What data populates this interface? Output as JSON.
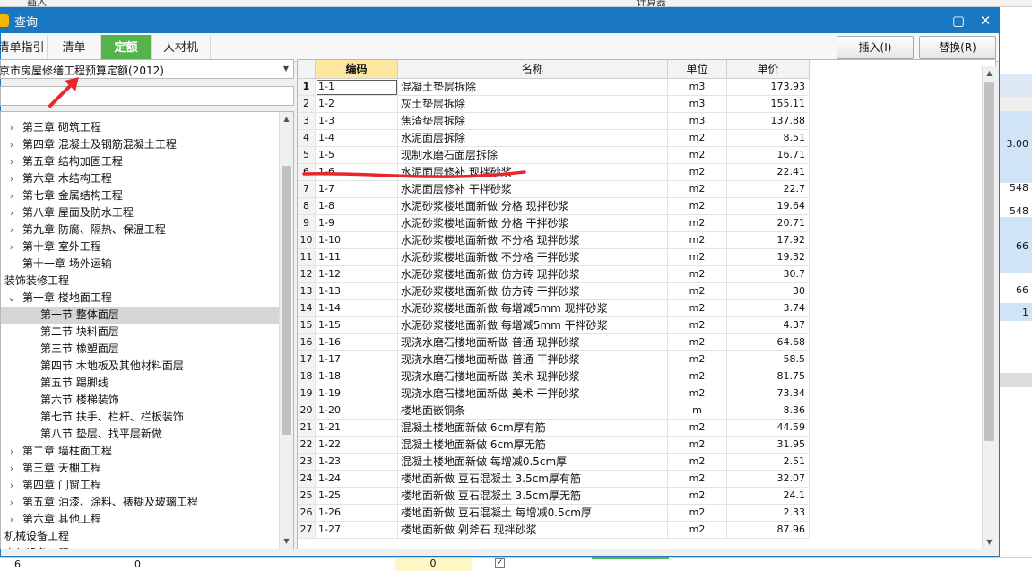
{
  "background": {
    "top_insert_label": "插入",
    "top_calc_label": "计算器",
    "right_values": [
      "3.00",
      "548",
      "548",
      "66",
      "66",
      "1"
    ],
    "bottom_values": [
      "6",
      "0",
      "0"
    ]
  },
  "dialog": {
    "title": "查询",
    "tabs": [
      "清单指引",
      "清单",
      "定额",
      "人材机"
    ],
    "active_tab": 2,
    "insert_label": "插入(I)",
    "replace_label": "替换(R)"
  },
  "left": {
    "library": "京市房屋修缮工程预算定额(2012)",
    "tree": [
      {
        "label": "第三章 砌筑工程",
        "level": 1,
        "toggle": ">"
      },
      {
        "label": "第四章 混凝土及钢筋混凝土工程",
        "level": 1,
        "toggle": ">"
      },
      {
        "label": "第五章 结构加固工程",
        "level": 1,
        "toggle": ">"
      },
      {
        "label": "第六章 木结构工程",
        "level": 1,
        "toggle": ">"
      },
      {
        "label": "第七章 金属结构工程",
        "level": 1,
        "toggle": ">"
      },
      {
        "label": "第八章 屋面及防水工程",
        "level": 1,
        "toggle": ">"
      },
      {
        "label": "第九章 防腐、隔热、保温工程",
        "level": 1,
        "toggle": ">"
      },
      {
        "label": "第十章 室外工程",
        "level": 1,
        "toggle": ">"
      },
      {
        "label": "第十一章 场外运输",
        "level": 1,
        "toggle": ""
      },
      {
        "label": "装饰装修工程",
        "level": 0,
        "toggle": ""
      },
      {
        "label": "第一章 楼地面工程",
        "level": 1,
        "toggle": "v"
      },
      {
        "label": "第一节 整体面层",
        "level": 2,
        "toggle": "",
        "selected": true
      },
      {
        "label": "第二节 块料面层",
        "level": 2,
        "toggle": ""
      },
      {
        "label": "第三节 橡塑面层",
        "level": 2,
        "toggle": ""
      },
      {
        "label": "第四节 木地板及其他材料面层",
        "level": 2,
        "toggle": ""
      },
      {
        "label": "第五节 踢脚线",
        "level": 2,
        "toggle": ""
      },
      {
        "label": "第六节 楼梯装饰",
        "level": 2,
        "toggle": ""
      },
      {
        "label": "第七节 扶手、栏杆、栏板装饰",
        "level": 2,
        "toggle": ""
      },
      {
        "label": "第八节 垫层、找平层新做",
        "level": 2,
        "toggle": ""
      },
      {
        "label": "第二章 墙柱面工程",
        "level": 1,
        "toggle": ">"
      },
      {
        "label": "第三章 天棚工程",
        "level": 1,
        "toggle": ">"
      },
      {
        "label": "第四章 门窗工程",
        "level": 1,
        "toggle": ">"
      },
      {
        "label": "第五章 油漆、涂料、裱糊及玻璃工程",
        "level": 1,
        "toggle": ">"
      },
      {
        "label": "第六章 其他工程",
        "level": 1,
        "toggle": ">"
      },
      {
        "label": "机械设备工程",
        "level": 0,
        "toggle": ""
      },
      {
        "label": "电气设备工程",
        "level": 0,
        "toggle": ""
      }
    ]
  },
  "grid": {
    "headers": {
      "code": "编码",
      "name": "名称",
      "unit": "单位",
      "price": "单价"
    },
    "rows": [
      {
        "n": "1",
        "code": "1-1",
        "name": "混凝土垫层拆除",
        "unit": "m3",
        "price": "173.93"
      },
      {
        "n": "2",
        "code": "1-2",
        "name": "灰土垫层拆除",
        "unit": "m3",
        "price": "155.11"
      },
      {
        "n": "3",
        "code": "1-3",
        "name": "焦渣垫层拆除",
        "unit": "m3",
        "price": "137.88"
      },
      {
        "n": "4",
        "code": "1-4",
        "name": "水泥面层拆除",
        "unit": "m2",
        "price": "8.51"
      },
      {
        "n": "5",
        "code": "1-5",
        "name": "现制水磨石面层拆除",
        "unit": "m2",
        "price": "16.71"
      },
      {
        "n": "6",
        "code": "1-6",
        "name": "水泥面层修补 现拌砂浆",
        "unit": "m2",
        "price": "22.41"
      },
      {
        "n": "7",
        "code": "1-7",
        "name": "水泥面层修补 干拌砂浆",
        "unit": "m2",
        "price": "22.7"
      },
      {
        "n": "8",
        "code": "1-8",
        "name": "水泥砂浆楼地面新做 分格 现拌砂浆",
        "unit": "m2",
        "price": "19.64"
      },
      {
        "n": "9",
        "code": "1-9",
        "name": "水泥砂浆楼地面新做 分格 干拌砂浆",
        "unit": "m2",
        "price": "20.71"
      },
      {
        "n": "10",
        "code": "1-10",
        "name": "水泥砂浆楼地面新做 不分格 现拌砂浆",
        "unit": "m2",
        "price": "17.92"
      },
      {
        "n": "11",
        "code": "1-11",
        "name": "水泥砂浆楼地面新做 不分格 干拌砂浆",
        "unit": "m2",
        "price": "19.32"
      },
      {
        "n": "12",
        "code": "1-12",
        "name": "水泥砂浆楼地面新做 仿方砖 现拌砂浆",
        "unit": "m2",
        "price": "30.7"
      },
      {
        "n": "13",
        "code": "1-13",
        "name": "水泥砂浆楼地面新做 仿方砖 干拌砂浆",
        "unit": "m2",
        "price": "30"
      },
      {
        "n": "14",
        "code": "1-14",
        "name": "水泥砂浆楼地面新做 每增减5mm 现拌砂浆",
        "unit": "m2",
        "price": "3.74"
      },
      {
        "n": "15",
        "code": "1-15",
        "name": "水泥砂浆楼地面新做 每增减5mm 干拌砂浆",
        "unit": "m2",
        "price": "4.37"
      },
      {
        "n": "16",
        "code": "1-16",
        "name": "现浇水磨石楼地面新做 普通 现拌砂浆",
        "unit": "m2",
        "price": "64.68"
      },
      {
        "n": "17",
        "code": "1-17",
        "name": "现浇水磨石楼地面新做 普通 干拌砂浆",
        "unit": "m2",
        "price": "58.5"
      },
      {
        "n": "18",
        "code": "1-18",
        "name": "现浇水磨石楼地面新做 美术 现拌砂浆",
        "unit": "m2",
        "price": "81.75"
      },
      {
        "n": "19",
        "code": "1-19",
        "name": "现浇水磨石楼地面新做 美术 干拌砂浆",
        "unit": "m2",
        "price": "73.34"
      },
      {
        "n": "20",
        "code": "1-20",
        "name": "楼地面嵌铜条",
        "unit": "m",
        "price": "8.36"
      },
      {
        "n": "21",
        "code": "1-21",
        "name": "混凝土楼地面新做 6cm厚有筋",
        "unit": "m2",
        "price": "44.59"
      },
      {
        "n": "22",
        "code": "1-22",
        "name": "混凝土楼地面新做 6cm厚无筋",
        "unit": "m2",
        "price": "31.95"
      },
      {
        "n": "23",
        "code": "1-23",
        "name": "混凝土楼地面新做 每增减0.5cm厚",
        "unit": "m2",
        "price": "2.51"
      },
      {
        "n": "24",
        "code": "1-24",
        "name": "楼地面新做 豆石混凝土 3.5cm厚有筋",
        "unit": "m2",
        "price": "32.07"
      },
      {
        "n": "25",
        "code": "1-25",
        "name": "楼地面新做 豆石混凝土 3.5cm厚无筋",
        "unit": "m2",
        "price": "24.1"
      },
      {
        "n": "26",
        "code": "1-26",
        "name": "楼地面新做 豆石混凝土 每增减0.5cm厚",
        "unit": "m2",
        "price": "2.33"
      },
      {
        "n": "27",
        "code": "1-27",
        "name": "楼地面新做 剁斧石 现拌砂浆",
        "unit": "m2",
        "price": "87.96"
      }
    ]
  },
  "colors": {
    "titlebar": "#1a78c2",
    "active_tab": "#55b24d",
    "code_header": "#fbe7a0",
    "annotation": "#e8262c"
  }
}
